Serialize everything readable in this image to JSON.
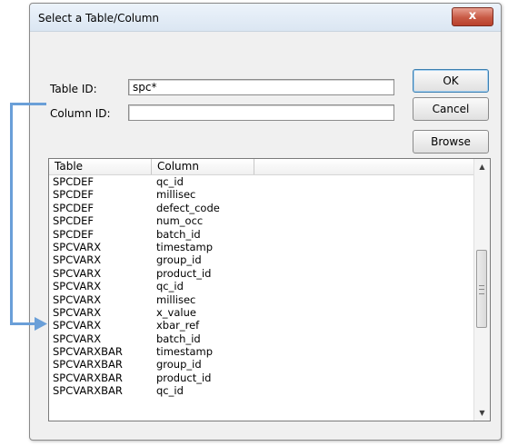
{
  "dialog": {
    "title": "Select a Table/Column",
    "close_glyph": "x"
  },
  "form": {
    "table_id_label": "Table ID:",
    "table_id_value": "spc*",
    "column_id_label": "Column ID:",
    "column_id_value": ""
  },
  "buttons": {
    "ok": "OK",
    "cancel": "Cancel",
    "browse": "Browse"
  },
  "list": {
    "headers": [
      "Table",
      "Column",
      ""
    ],
    "rows": [
      {
        "table": "SPCDEF",
        "column": "qc_id"
      },
      {
        "table": "SPCDEF",
        "column": "millisec"
      },
      {
        "table": "SPCDEF",
        "column": "defect_code"
      },
      {
        "table": "SPCDEF",
        "column": "num_occ"
      },
      {
        "table": "SPCDEF",
        "column": "batch_id"
      },
      {
        "table": "SPCVARX",
        "column": "timestamp"
      },
      {
        "table": "SPCVARX",
        "column": "group_id"
      },
      {
        "table": "SPCVARX",
        "column": "product_id"
      },
      {
        "table": "SPCVARX",
        "column": "qc_id"
      },
      {
        "table": "SPCVARX",
        "column": "millisec"
      },
      {
        "table": "SPCVARX",
        "column": "x_value"
      },
      {
        "table": "SPCVARX",
        "column": "xbar_ref"
      },
      {
        "table": "SPCVARX",
        "column": "batch_id"
      },
      {
        "table": "SPCVARXBAR",
        "column": "timestamp"
      },
      {
        "table": "SPCVARXBAR",
        "column": "group_id"
      },
      {
        "table": "SPCVARXBAR",
        "column": "product_id"
      },
      {
        "table": "SPCVARXBAR",
        "column": "qc_id"
      }
    ]
  },
  "scrollbar": {
    "up_glyph": "▲",
    "down_glyph": "▼"
  },
  "colors": {
    "annotation_arrow": "#6a9fd8",
    "close_button": "#c85a45"
  }
}
